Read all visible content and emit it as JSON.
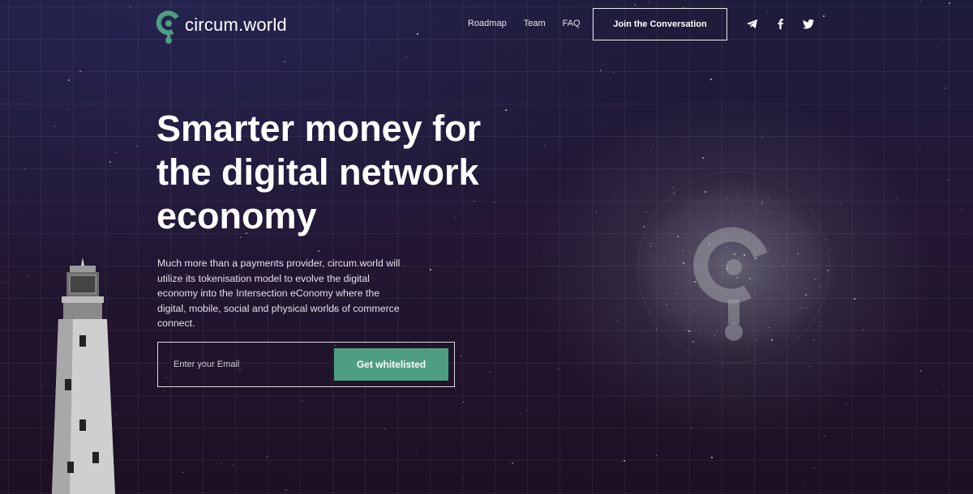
{
  "brand": {
    "name": "circum.world",
    "accent_color": "#4e9e83"
  },
  "nav": {
    "links": [
      "Roadmap",
      "Team",
      "FAQ"
    ],
    "cta_label": "Join the Conversation",
    "social_icons": [
      "telegram-icon",
      "facebook-icon",
      "twitter-icon"
    ]
  },
  "hero": {
    "headline": "Smarter money for the digital network economy",
    "description": "Much more than a payments provider, circum.world will utilize its tokenisation model to evolve the digital economy into the Intersection eConomy where the digital, mobile, social and physical worlds of commerce connect.",
    "email_placeholder": "Enter your Email",
    "email_value": "",
    "submit_label": "Get whitelisted"
  }
}
